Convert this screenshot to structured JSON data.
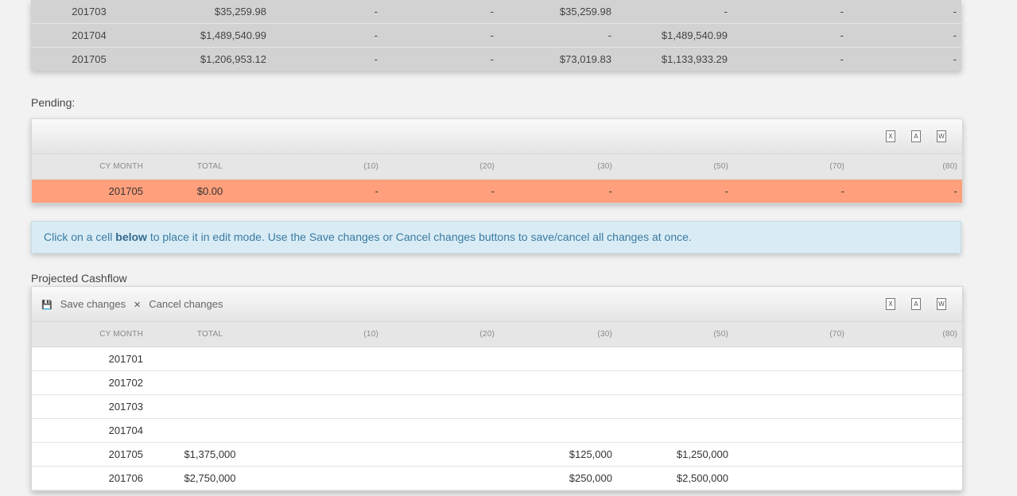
{
  "actuals": {
    "rows": [
      [
        "201703",
        "$35,259.98",
        "-",
        "-",
        "$35,259.98",
        "-",
        "-",
        "-"
      ],
      [
        "201704",
        "$1,489,540.99",
        "-",
        "-",
        "-",
        "$1,489,540.99",
        "-",
        "-"
      ],
      [
        "201705",
        "$1,206,953.12",
        "-",
        "-",
        "$73,019.83",
        "$1,133,933.29",
        "-",
        "-"
      ]
    ]
  },
  "pending": {
    "label": "Pending:",
    "columns": [
      "CY MONTH",
      "TOTAL",
      "(10)",
      "(20)",
      "(30)",
      "(50)",
      "(70)",
      "(80)"
    ],
    "rows": [
      [
        "201705",
        "$0.00",
        "-",
        "-",
        "-",
        "-",
        "-",
        "-"
      ]
    ],
    "row_color": "#ff9f7b"
  },
  "info": {
    "prefix": "Click on a cell ",
    "bold": "below",
    "suffix": " to place it in edit mode. Use the Save changes or Cancel changes buttons to save/cancel all changes at once."
  },
  "projected": {
    "label": "Projected Cashflow",
    "save_label": "Save changes",
    "cancel_label": "Cancel changes",
    "columns": [
      "CY MONTH",
      "TOTAL",
      "(10)",
      "(20)",
      "(30)",
      "(50)",
      "(70)",
      "(80)"
    ],
    "rows": [
      [
        "201701",
        "",
        "",
        "",
        "",
        "",
        "",
        ""
      ],
      [
        "201702",
        "",
        "",
        "",
        "",
        "",
        "",
        ""
      ],
      [
        "201703",
        "",
        "",
        "",
        "",
        "",
        "",
        ""
      ],
      [
        "201704",
        "",
        "",
        "",
        "",
        "",
        "",
        ""
      ],
      [
        "201705",
        "$1,375,000",
        "",
        "",
        "$125,000",
        "$1,250,000",
        "",
        ""
      ],
      [
        "201706",
        "$2,750,000",
        "",
        "",
        "$250,000",
        "$2,500,000",
        "",
        ""
      ]
    ]
  },
  "icons": {
    "export": [
      "excel-export-icon",
      "pdf-export-icon",
      "word-export-icon"
    ],
    "save": "save-icon",
    "cancel": "close-icon"
  }
}
